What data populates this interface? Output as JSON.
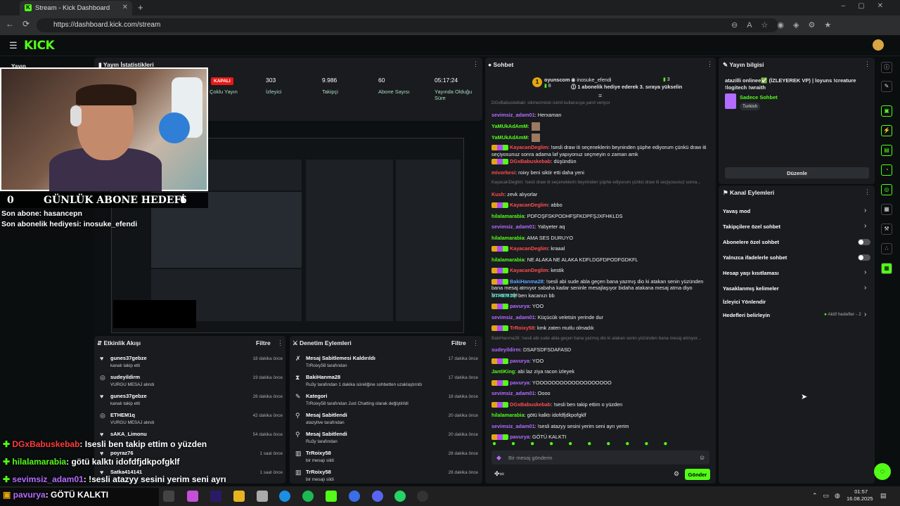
{
  "browser": {
    "tab_title": "Stream - Kick Dashboard",
    "url": "https://dashboard.kick.com/stream"
  },
  "header": {
    "logo": "KICK"
  },
  "sidebar": {
    "label": "Yayın"
  },
  "stats": {
    "title": "Yayın İstatistikleri",
    "status_badge": "KAPALI",
    "status_label": "Çoklu Yayın",
    "viewers": "303",
    "viewers_label": "İzleyici",
    "followers": "9.986",
    "followers_label": "Takipçi",
    "subs": "60",
    "subs_label": "Abone Sayısı",
    "uptime": "05:17:24",
    "uptime_label": "Yayında Olduğu Süre"
  },
  "overlay": {
    "goal_left": "0",
    "goal_title": "GÜNLÜK ABONE HEDEFİ",
    "goal_right": "6",
    "last_sub": "Son abone: hasancepn",
    "last_gift": "Son abonelik hediyesi: inosuke_efendi",
    "chat_1_user": "DGxBabuskebab",
    "chat_1_text": ": Isesli ben takip ettim o yüzden",
    "chat_2_user": "hilalamarabia",
    "chat_2_text": ": götü kalktı idofdfjdkpofgklf",
    "chat_3_user": "sevimsiz_adam01",
    "chat_3_text": ": !sesli atazyy sesini yerim seni ayrı",
    "chat_4_user": "pavurya",
    "chat_4_text": ": GÖTÜ KALKTI"
  },
  "activity": {
    "title": "Etkinlik Akışı",
    "filter": "Filtre",
    "items": [
      {
        "name": "gunes37gebze",
        "sub": "kanalı takip etti",
        "time": "18 dakika önce"
      },
      {
        "name": "sudeyildirm",
        "sub": "VURGU MESAJ alındı",
        "time": "19 dakika önce"
      },
      {
        "name": "gunes37gebze",
        "sub": "kanalı takip etti",
        "time": "28 dakika önce"
      },
      {
        "name": "ETHEM1q",
        "sub": "VURGU MESAJ alındı",
        "time": "42 dakika önce"
      },
      {
        "name": "sAKA_Limonu",
        "sub": "",
        "time": "54 dakika önce"
      },
      {
        "name": "poyraz76",
        "sub": "",
        "time": "1 saat önce"
      },
      {
        "name": "Satka414141",
        "sub": "",
        "time": "1 saat önce"
      }
    ]
  },
  "modlog": {
    "title": "Denetim Eylemleri",
    "filter": "Filtre",
    "items": [
      {
        "name": "Mesaj Sabitlemesi Kaldırıldı",
        "sub": "TrRoixy58 tarafından",
        "time": "17 dakika önce"
      },
      {
        "name": "BakiHanma28",
        "sub": "Ru3y tarafından 1 dakika süreliğine sohbetten uzaklaştırıldı",
        "time": "17 dakika önce"
      },
      {
        "name": "Kategori",
        "sub": "TrRoixy58 tarafından Just Chatting olarak değiştirildi",
        "time": "18 dakika önce"
      },
      {
        "name": "Mesaj Sabitlendi",
        "sub": "atazyllve tarafından",
        "time": "20 dakika önce"
      },
      {
        "name": "Mesaj Sabitlendi",
        "sub": "Ru3y tarafından",
        "time": "20 dakika önce"
      },
      {
        "name": "TrRoixy58",
        "sub": "bir mesajı sildi",
        "time": "28 dakika önce"
      },
      {
        "name": "TrRoixy58",
        "sub": "bir mesajı sildi",
        "time": "28 dakika önce"
      }
    ]
  },
  "chat": {
    "title": "Sohbet",
    "pinned_user": "oyunscom",
    "pinned_count": "8",
    "pinned_gifter": "inosuke_efendi",
    "pinned_gifter_count": "3",
    "pinned_text": "1 abonelik hediye ederek 3. sıraya yükselin",
    "messages": [
      {
        "reply": "DGxBabuskebab: sikmezmisin isimli kullanıcıya yanıt veriyor",
        "user": "",
        "text": ""
      },
      {
        "user": "sevimsiz_adam01",
        "text": ": Herxaman"
      },
      {
        "user": "YaMUkAdAmM",
        "text": ":"
      },
      {
        "user": "YaMUkAdAmM",
        "text": ":"
      },
      {
        "user": "KayacanDeglim",
        "text": ": !sesli draw iti seçeneklerin beyninden şüphe ediyorum çünkü draw iti seçiyosunuz sonra adama laf yapıyonuz seçmeyin o zaman amk"
      },
      {
        "user": "DGxBabuskebab",
        "text": ": düşündün"
      },
      {
        "user": "mivorkesi",
        "text": ": roixy beni siktir etti daha yeni"
      },
      {
        "reply": "KayacanDeglim: !sesli draw iti seçeneklerin beyninden şüphe ediyorum çünkü draw iti seçiyosunuz sonra...",
        "user": "",
        "text": ""
      },
      {
        "user": "Kush",
        "text": ": zevk alıyorlar"
      },
      {
        "user": "KayacanDeglim",
        "text": ": abbo"
      },
      {
        "user": "hilalamarabia",
        "text": ": PDFOŞFSKPODHFŞFKDPFŞJXFHKLDS"
      },
      {
        "user": "sevimsiz_adam01",
        "text": ": Yabyeter aq"
      },
      {
        "user": "hilalamarabia",
        "text": ": AMA SES DURUYO"
      },
      {
        "user": "KayacanDeglim",
        "text": ": kraaal"
      },
      {
        "user": "hilalamarabia",
        "text": ": NE ALAKA NE ALAKA KDFLDGFDPODFGDKFL"
      },
      {
        "user": "KayacanDeglim",
        "text": ": kestik"
      },
      {
        "user": "BakiHanma28",
        "text": ": !sesli abi sude abla geçen bana yazmış dio ki atakan senin yüzünden bana mesaj atmıyor sabaha kadar seninle mesajlaşıyor bidaha atakana mesaj atma diyo kızsana abi"
      },
      {
        "user": "ETHEM1q",
        "text": ": ben kacanızı bb"
      },
      {
        "user": "pavurya",
        "text": ": YOO"
      },
      {
        "user": "sevimsiz_adam01",
        "text": ": Küçücük veletsin yerinde dur"
      },
      {
        "user": "TrRoixy58",
        "text": ": kmk zaten mutlu olmadık"
      },
      {
        "reply": "BakiHanma28: !sesli abi sude abla geçen bana yazmış dio ki atakan senin yüzünden bana mesaj atmıyor...",
        "user": "",
        "text": ""
      },
      {
        "user": "sudeyildirm",
        "text": ": DSAFSDFSDAFASD"
      },
      {
        "user": "pavurya",
        "text": ": YOO"
      },
      {
        "user": "JantiKing",
        "text": ": abi laz ziya racon izleyek"
      },
      {
        "user": "pavurya",
        "text": ": YOOOOOOOOOOOOOOOOOOO"
      },
      {
        "user": "sevimsiz_adam01",
        "text": ": Oooo"
      },
      {
        "user": "DGxBabuskebab",
        "text": ": !sesli ben takip ettim o yüzden"
      },
      {
        "user": "hilalamarabia",
        "text": ": götü kalktı idofdfjdkpofgklf"
      },
      {
        "user": "sevimsiz_adam01",
        "text": ": !sesli atazyy sesini yerim seni ayrı yerim"
      },
      {
        "user": "pavurya",
        "text": ": GÖTÜ KALKTI"
      }
    ],
    "input_placeholder": "Bir mesaj gönderin",
    "send_label": "Gönder"
  },
  "stream_info": {
    "title": "Yayın bilgisi",
    "stream_title": "atazilli onlinee✅ (İZLEYEREK VP) | loyuns !creature !logitech !wraith",
    "category": "Sadece Sohbet",
    "language": "Turkish",
    "edit_label": "Düzenle"
  },
  "channel_actions": {
    "title": "Kanal Eylemleri",
    "items": [
      {
        "label": "Yavaş mod",
        "control": "chevron"
      },
      {
        "label": "Takipçilere özel sohbet",
        "control": "chevron"
      },
      {
        "label": "Abonelere özel sohbet",
        "control": "toggle"
      },
      {
        "label": "Yalnızca ifadelerle sohbet",
        "control": "toggle"
      },
      {
        "label": "Hesap yaşı kısıtlaması",
        "control": "chevron"
      },
      {
        "label": "Yasaklanmış kelimeler",
        "control": "chevron"
      },
      {
        "label": "İzleyici Yönlendir",
        "control": "none"
      },
      {
        "label": "Hedefleri belirleyin",
        "control": "chevron"
      }
    ],
    "goals_badge": "Aktif hedefler - 2"
  },
  "taskbar": {
    "time": "01:57",
    "date": "16.08.2025"
  },
  "colors": {
    "accent": "#53fc18",
    "live_red": "#e91916",
    "panel": "#191b1f"
  }
}
